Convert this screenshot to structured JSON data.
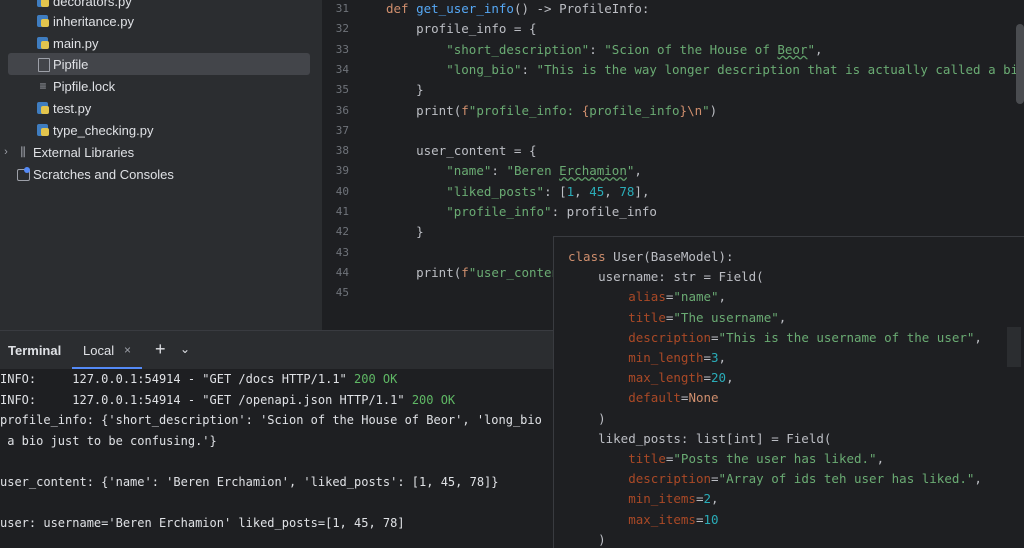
{
  "project_tree": {
    "items": [
      {
        "label": "decorators.py",
        "icon": "python-file-icon"
      },
      {
        "label": "inheritance.py",
        "icon": "python-file-icon"
      },
      {
        "label": "main.py",
        "icon": "python-file-icon"
      },
      {
        "label": "Pipfile",
        "icon": "pipfile-icon",
        "selected": true
      },
      {
        "label": "Pipfile.lock",
        "icon": "text-file-icon"
      },
      {
        "label": "test.py",
        "icon": "python-file-icon"
      },
      {
        "label": "type_checking.py",
        "icon": "python-file-icon"
      }
    ],
    "external_libraries": "External Libraries",
    "scratches": "Scratches and Consoles"
  },
  "editor": {
    "line_numbers": [
      "31",
      "32",
      "33",
      "34",
      "35",
      "36",
      "37",
      "38",
      "39",
      "40",
      "41",
      "42",
      "43",
      "44",
      "45"
    ],
    "lines": [
      "def get_user_info() -> ProfileInfo:",
      "    profile_info = {",
      "        \"short_description\": \"Scion of the House of Beor\",",
      "        \"long_bio\": \"This is the way longer description that is actually called a bio just",
      "    }",
      "    print(f\"profile_info: {profile_info}\\n\")",
      "",
      "    user_content = {",
      "        \"name\": \"Beren Erchamion\",",
      "        \"liked_posts\": [1, 45, 78],",
      "        \"profile_info\": profile_info",
      "    }",
      "",
      "    print(f\"user_content",
      ""
    ]
  },
  "terminal": {
    "title": "Terminal",
    "tab_label": "Local",
    "close_glyph": "×",
    "add_glyph": "+",
    "dropdown_glyph": "⌄",
    "lines": [
      {
        "prefix": "INFO:     127.0.0.1:54914 - \"GET /docs HTTP/1.1\" ",
        "status": "200 OK"
      },
      {
        "prefix": "INFO:     127.0.0.1:54914 - \"GET /openapi.json HTTP/1.1\" ",
        "status": "200 OK"
      },
      {
        "prefix": "profile_info: {'short_description': 'Scion of the House of Beor', 'long_bio",
        "status": ""
      },
      {
        "prefix": " a bio just to be confusing.'}",
        "status": ""
      },
      {
        "prefix": "",
        "status": ""
      },
      {
        "prefix": "user_content: {'name': 'Beren Erchamion', 'liked_posts': [1, 45, 78]}",
        "status": ""
      },
      {
        "prefix": "",
        "status": ""
      },
      {
        "prefix": "user: username='Beren Erchamion' liked_posts=[1, 45, 78]",
        "status": ""
      }
    ]
  },
  "popup": {
    "lines": [
      "class User(BaseModel):",
      "    username: str = Field(",
      "        alias=\"name\",",
      "        title=\"The username\",",
      "        description=\"This is the username of the user\",",
      "        min_length=3,",
      "        max_length=20,",
      "        default=None",
      "    )",
      "    liked_posts: list[int] = Field(",
      "        title=\"Posts the user has liked.\",",
      "        description=\"Array of ids teh user has liked.\",",
      "        min_items=2,",
      "        max_items=10",
      "    )"
    ]
  }
}
